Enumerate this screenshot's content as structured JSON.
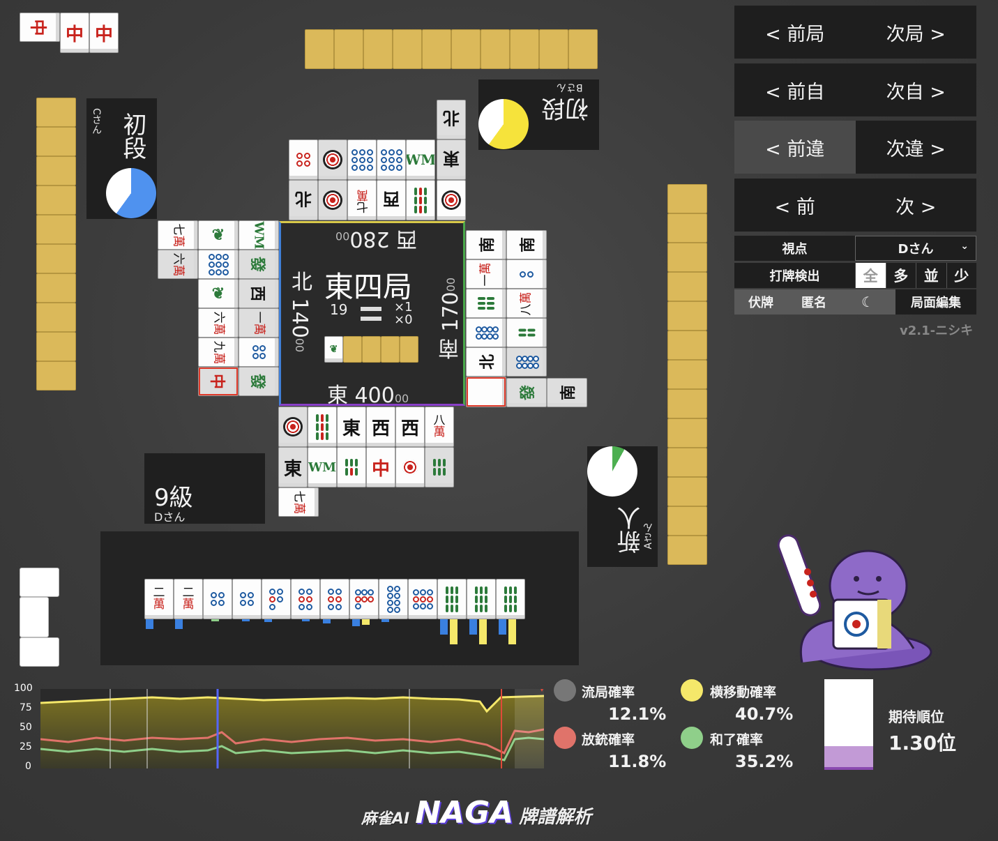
{
  "round": {
    "title": "東四局",
    "honba": "19",
    "stick_x1": "×1",
    "stick_x0": "×0"
  },
  "scores": {
    "top": {
      "wind": "西",
      "value": "280",
      "small": "00"
    },
    "left": {
      "wind": "北",
      "value": "140",
      "small": "00"
    },
    "right": {
      "wind": "南",
      "value": "170",
      "small": "00"
    },
    "bottom": {
      "wind": "東",
      "value": "400",
      "small": "00"
    }
  },
  "players": {
    "top": {
      "rank": "初段",
      "name": "Bさん",
      "pie_color": "#f6e33b",
      "pie_fraction": 0.6
    },
    "left": {
      "rank": "初段",
      "name": "Cさん",
      "pie_color": "#4f92ef",
      "pie_fraction": 0.6
    },
    "right": {
      "rank": "新人",
      "name": "Aさん",
      "pie_color": "#4caf50",
      "pie_fraction": 0.08
    },
    "bottom": {
      "rank": "9級",
      "name": "Dさん"
    }
  },
  "nav": {
    "prev_round": "< 前局",
    "next_round": "次局 >",
    "prev_self": "< 前自",
    "next_self": "次自 >",
    "prev_diff": "< 前違",
    "next_diff": "次違 >",
    "prev": "< 前",
    "next": "次 >"
  },
  "controls": {
    "viewpoint_label": "視点",
    "viewpoint_value": "Dさん",
    "detect_label": "打牌検出",
    "detect_options": [
      "全",
      "多",
      "並",
      "少"
    ],
    "hide_tiles": "伏牌",
    "anonymous": "匿名",
    "board_edit": "局面編集",
    "version": "v2.1-ニシキ"
  },
  "chart_data": {
    "type": "area",
    "yticks": [
      "100",
      "75",
      "50",
      "25",
      "0"
    ],
    "ylim": [
      0,
      100
    ],
    "series": [
      {
        "name": "横移動確率",
        "color": "#f5e86a"
      },
      {
        "name": "放銃確率",
        "color": "#e0736a"
      },
      {
        "name": "和了確率",
        "color": "#8fcf8a"
      }
    ]
  },
  "stats": {
    "draw_label": "流局確率",
    "draw_value": "12.1%",
    "draw_color": "#777777",
    "lateral_label": "横移動確率",
    "lateral_value": "40.7%",
    "lateral_color": "#f5e86a",
    "dealin_label": "放銃確率",
    "dealin_value": "11.8%",
    "dealin_color": "#e0736a",
    "win_label": "和了確率",
    "win_value": "35.2%",
    "win_color": "#8fcf8a",
    "expected_label": "期待順位",
    "expected_value": "1.30位"
  },
  "tiles": {
    "chun": "中",
    "hatsu": "發",
    "east": "東",
    "south": "南",
    "west": "西",
    "north": "北",
    "man": "萬",
    "n1": "一",
    "n2": "二",
    "n6": "六",
    "n7": "七",
    "n8": "八",
    "n9": "九"
  },
  "footer": {
    "brand_left": "麻雀AI",
    "brand_main": "NAGA",
    "brand_right": "牌譜解析"
  }
}
